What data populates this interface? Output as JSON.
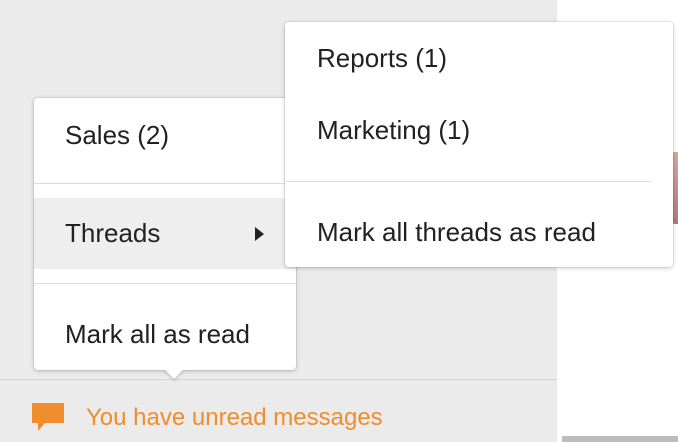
{
  "primary_menu": {
    "items": [
      {
        "label": "Sales (2)"
      },
      {
        "label": "Threads",
        "has_submenu": true
      },
      {
        "label": "Mark all as read"
      }
    ]
  },
  "threads_submenu": {
    "items": [
      {
        "label": "Reports (1)"
      },
      {
        "label": "Marketing (1)"
      },
      {
        "label": "Mark all threads as read"
      }
    ]
  },
  "notification": {
    "text": "You have unread messages",
    "icon": "chat-bubble-icon",
    "color": "#f08d2c"
  },
  "colors": {
    "background": "#ebebeb",
    "menu_background": "#ffffff",
    "highlight": "#eeeeee",
    "text": "#212121",
    "accent": "#f08d2c"
  }
}
